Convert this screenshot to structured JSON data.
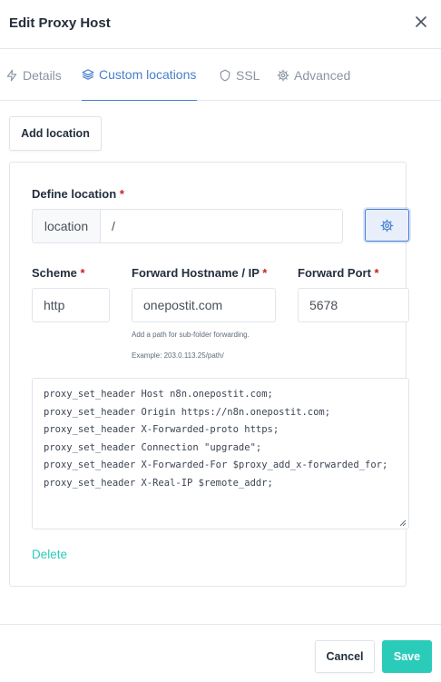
{
  "dialog": {
    "title": "Edit Proxy Host",
    "close_icon": "close-icon"
  },
  "tabs": [
    {
      "label": "Details",
      "icon": "lightning-icon",
      "active": false
    },
    {
      "label": "Custom locations",
      "icon": "layers-icon",
      "active": true
    },
    {
      "label": "SSL",
      "icon": "shield-icon",
      "active": false
    },
    {
      "label": "Advanced",
      "icon": "gear-icon",
      "active": false
    }
  ],
  "add_location_label": "Add location",
  "location": {
    "define_label": "Define location",
    "required_mark": "*",
    "addon": "location",
    "path_value": "/",
    "settings_icon": "gear-icon",
    "scheme_label": "Scheme",
    "scheme_value": "http",
    "hostname_label": "Forward Hostname / IP",
    "hostname_value": "onepostit.com",
    "hostname_help_1": "Add a path for sub-folder forwarding.",
    "hostname_help_2": "Example: 203.0.113.25/path/",
    "port_label": "Forward Port",
    "port_value": "5678",
    "config_lines": [
      "proxy_set_header Host n8n.onepostit.com;",
      "proxy_set_header Origin https://n8n.onepostit.com;",
      "proxy_set_header X-Forwarded-proto https;",
      "proxy_set_header Connection \"upgrade\";",
      "proxy_set_header X-Forwarded-For $proxy_add_x-forwarded_for;",
      "proxy_set_header X-Real-IP $remote_addr;"
    ],
    "delete_label": "Delete"
  },
  "footer": {
    "cancel_label": "Cancel",
    "save_label": "Save"
  },
  "colors": {
    "accent": "#467fcf",
    "teal": "#2bcbba",
    "required": "#cd201f"
  }
}
